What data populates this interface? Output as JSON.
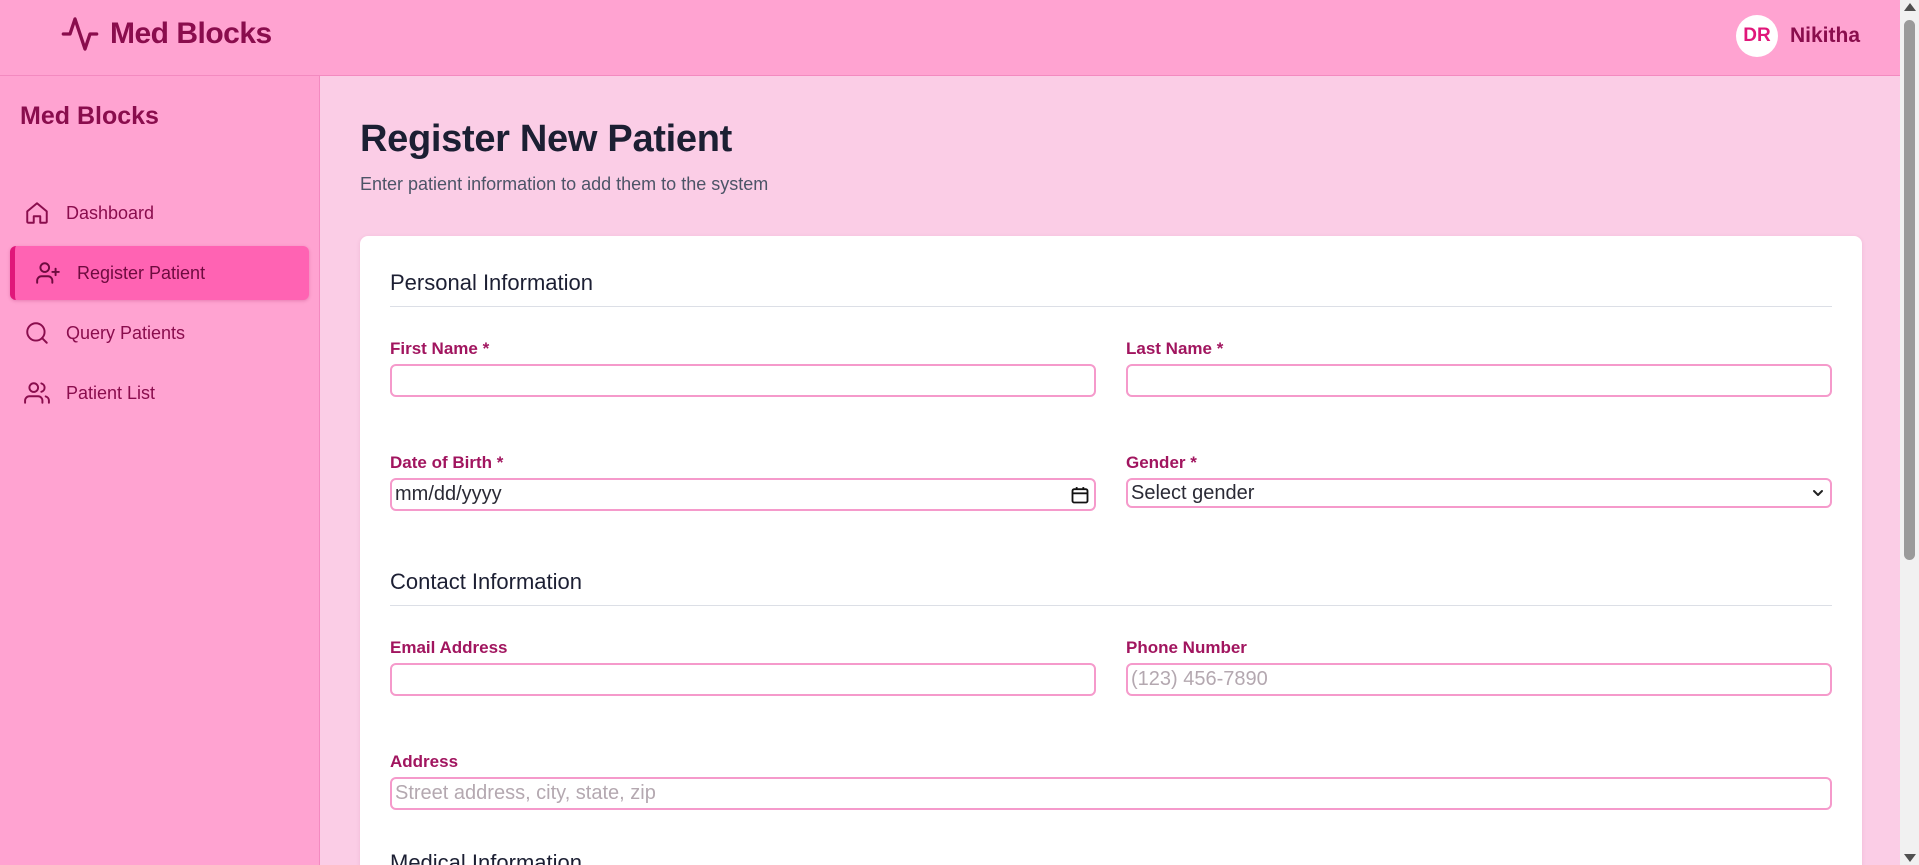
{
  "header": {
    "brand": "Med Blocks",
    "brand_icon": "activity-icon",
    "user_initials": "DR",
    "user_name": "Nikitha"
  },
  "sidebar": {
    "title": "Med Blocks",
    "items": [
      {
        "label": "Dashboard",
        "icon": "home-icon",
        "active": false
      },
      {
        "label": "Register Patient",
        "icon": "user-plus-icon",
        "active": true
      },
      {
        "label": "Query Patients",
        "icon": "search-icon",
        "active": false
      },
      {
        "label": "Patient List",
        "icon": "users-icon",
        "active": false
      }
    ]
  },
  "page": {
    "title": "Register New Patient",
    "subtitle": "Enter patient information to add them to the system"
  },
  "form": {
    "personal": {
      "title": "Personal Information",
      "first_name_label": "First Name *",
      "first_name_value": "",
      "last_name_label": "Last Name *",
      "last_name_value": "",
      "dob_label": "Date of Birth *",
      "dob_placeholder": "mm/dd/yyyy",
      "gender_label": "Gender *",
      "gender_value": "Select gender"
    },
    "contact": {
      "title": "Contact Information",
      "email_label": "Email Address",
      "email_value": "",
      "phone_label": "Phone Number",
      "phone_placeholder": "(123) 456-7890",
      "address_label": "Address",
      "address_placeholder": "Street address, city, state, zip"
    },
    "medical": {
      "title": "Medical Information"
    }
  },
  "colors": {
    "accent": "#e0177a",
    "label": "#a1155f",
    "sidebar_bg": "#ffa3d1",
    "page_bg": "#fbcde6"
  }
}
